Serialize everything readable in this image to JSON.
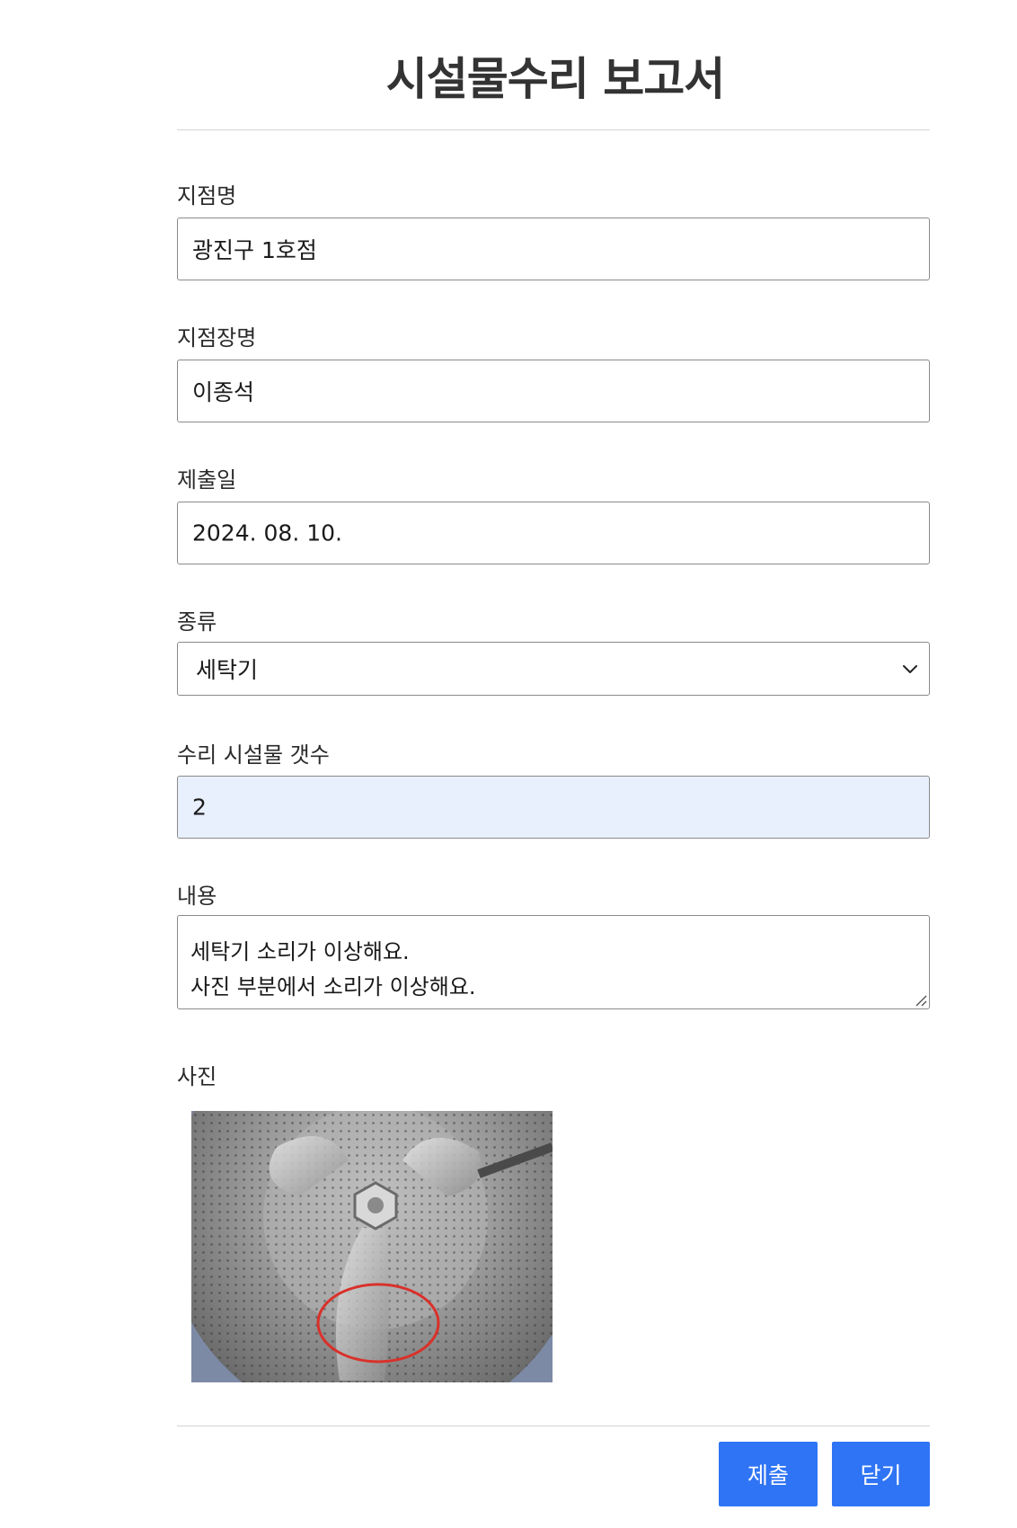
{
  "page": {
    "title": "시설물수리 보고서"
  },
  "form": {
    "branch_name": {
      "label": "지점명",
      "value": "광진구 1호점"
    },
    "manager_name": {
      "label": "지점장명",
      "value": "이종석"
    },
    "submit_date": {
      "label": "제출일",
      "value": "2024. 08. 10."
    },
    "category": {
      "label": "종류",
      "selected": "세탁기"
    },
    "repair_count": {
      "label": "수리 시설물 갯수",
      "value": "2"
    },
    "content": {
      "label": "내용",
      "lines": [
        "세탁기 소리가 이상해요.",
        "사진 부분에서 소리가 이상해요."
      ]
    },
    "photo": {
      "label": "사진"
    }
  },
  "actions": {
    "submit_label": "제출",
    "close_label": "닫기"
  },
  "colors": {
    "primary_button": "#2f74f5",
    "autofill_background": "#e8effd",
    "photo_highlight": "#d9312a"
  },
  "icons": {
    "select_indicator": "chevron-down-icon",
    "textarea_resize": "resize-handle-icon"
  }
}
